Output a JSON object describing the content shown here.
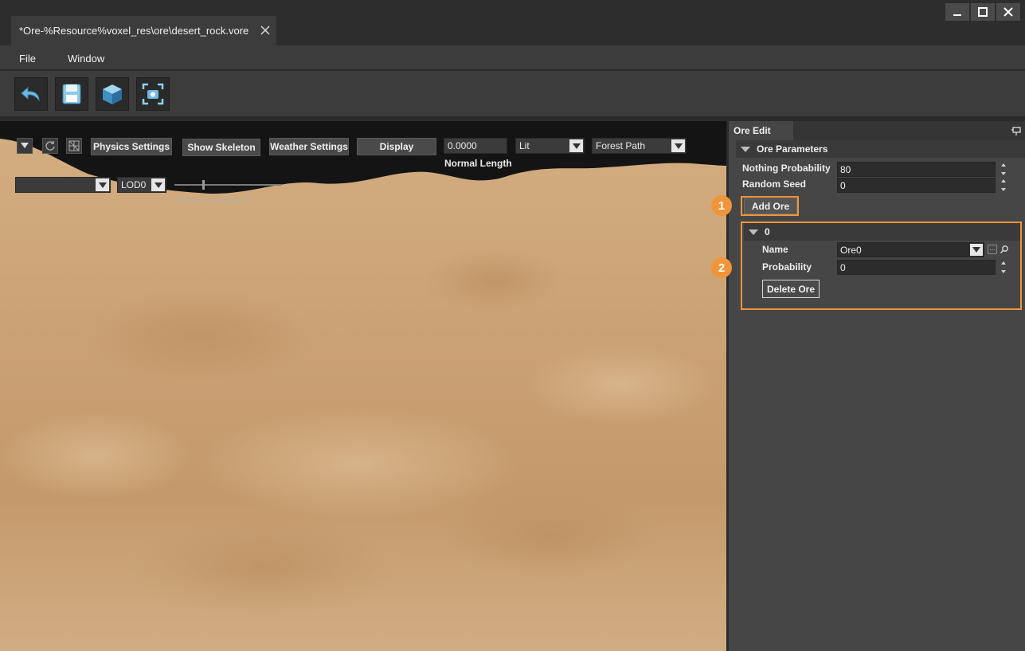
{
  "window": {
    "tab_title": "*Ore-%Resource%voxel_res\\ore\\desert_rock.vore",
    "tab_close_icon": "close-icon",
    "controls": [
      "minimize-icon",
      "maximize-icon",
      "close-icon"
    ]
  },
  "menubar": {
    "items": [
      "File",
      "Window"
    ]
  },
  "toolbar": {
    "buttons": [
      "undo-icon",
      "save-icon",
      "cube-icon",
      "focus-camera-icon"
    ]
  },
  "viewport": {
    "physics_settings": "Physics Settings",
    "show_skeleton": "Show Skeleton",
    "weather_settings": "Weather Settings",
    "display": "Display",
    "normal_length_value": "0.0000",
    "normal_length_label": "Normal Length",
    "shading_mode": "Lit",
    "environment": "Forest Path",
    "lod_select_value": "",
    "lod": "LOD0",
    "camera_speed_label": "Camera Speed:5",
    "camera_speed_level": 0.27
  },
  "panel": {
    "tab": "Ore Edit",
    "section": "Ore Parameters",
    "nothing_probability_label": "Nothing Probability",
    "nothing_probability_value": "80",
    "random_seed_label": "Random Seed",
    "random_seed_value": "0",
    "add_ore_button": "Add Ore",
    "ore_entry": {
      "index": "0",
      "name_label": "Name",
      "name_value": "Ore0",
      "probability_label": "Probability",
      "probability_value": "0",
      "delete_button": "Delete Ore"
    },
    "callouts": [
      "1",
      "2"
    ]
  },
  "colors": {
    "accent_orange": "#f0953a",
    "panel_bg": "#464646",
    "sand": "#c9a57a"
  }
}
